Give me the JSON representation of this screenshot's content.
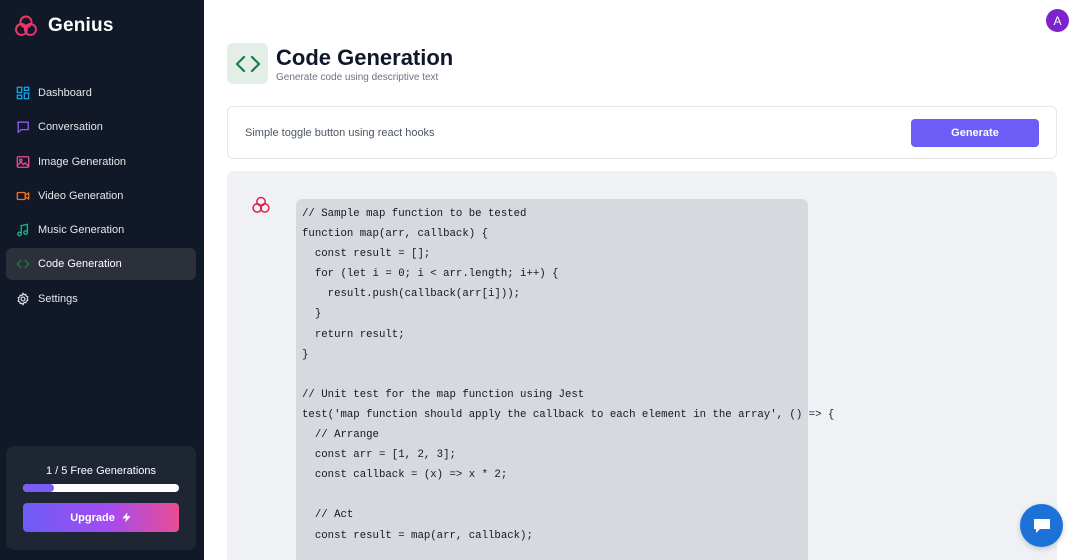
{
  "brand": {
    "name": "Genius"
  },
  "nav": {
    "items": [
      {
        "label": "Dashboard",
        "icon": "dashboard-icon",
        "color": "#0ea5e9",
        "active": false
      },
      {
        "label": "Conversation",
        "icon": "message-square-icon",
        "color": "#8b5cf6",
        "active": false
      },
      {
        "label": "Image Generation",
        "icon": "image-icon",
        "color": "#ec4899",
        "active": false
      },
      {
        "label": "Video Generation",
        "icon": "video-icon",
        "color": "#f97316",
        "active": false
      },
      {
        "label": "Music Generation",
        "icon": "music-icon",
        "color": "#10b981",
        "active": false
      },
      {
        "label": "Code Generation",
        "icon": "code-icon",
        "color": "#15803d",
        "active": true
      },
      {
        "label": "Settings",
        "icon": "settings-icon",
        "color": "#e5e7eb",
        "active": false
      }
    ]
  },
  "credits": {
    "label": "1 / 5 Free Generations",
    "used": 1,
    "limit": 5,
    "progress": 0.2,
    "upgrade_label": "Upgrade"
  },
  "user": {
    "avatar_initial": "A"
  },
  "header": {
    "title": "Code Generation",
    "subtitle": "Generate code using descriptive text"
  },
  "prompt": {
    "value": "Simple toggle button using react hooks",
    "button_label": "Generate"
  },
  "response": {
    "code_lines": [
      "// Sample map function to be tested",
      "function map(arr, callback) {",
      "  const result = [];",
      "  for (let i = 0; i < arr.length; i++) {",
      "    result.push(callback(arr[i]));",
      "  }",
      "  return result;",
      "}",
      "",
      "// Unit test for the map function using Jest",
      "test('map function should apply the callback to each element in the array', () => {",
      "  // Arrange",
      "  const arr = [1, 2, 3];",
      "  const callback = (x) => x * 2;",
      "",
      "  // Act",
      "  const result = map(arr, callback);"
    ]
  },
  "colors": {
    "accent": "#6d5cf6",
    "sidebar_bg": "#111827",
    "code_bg": "#d7d9de"
  }
}
